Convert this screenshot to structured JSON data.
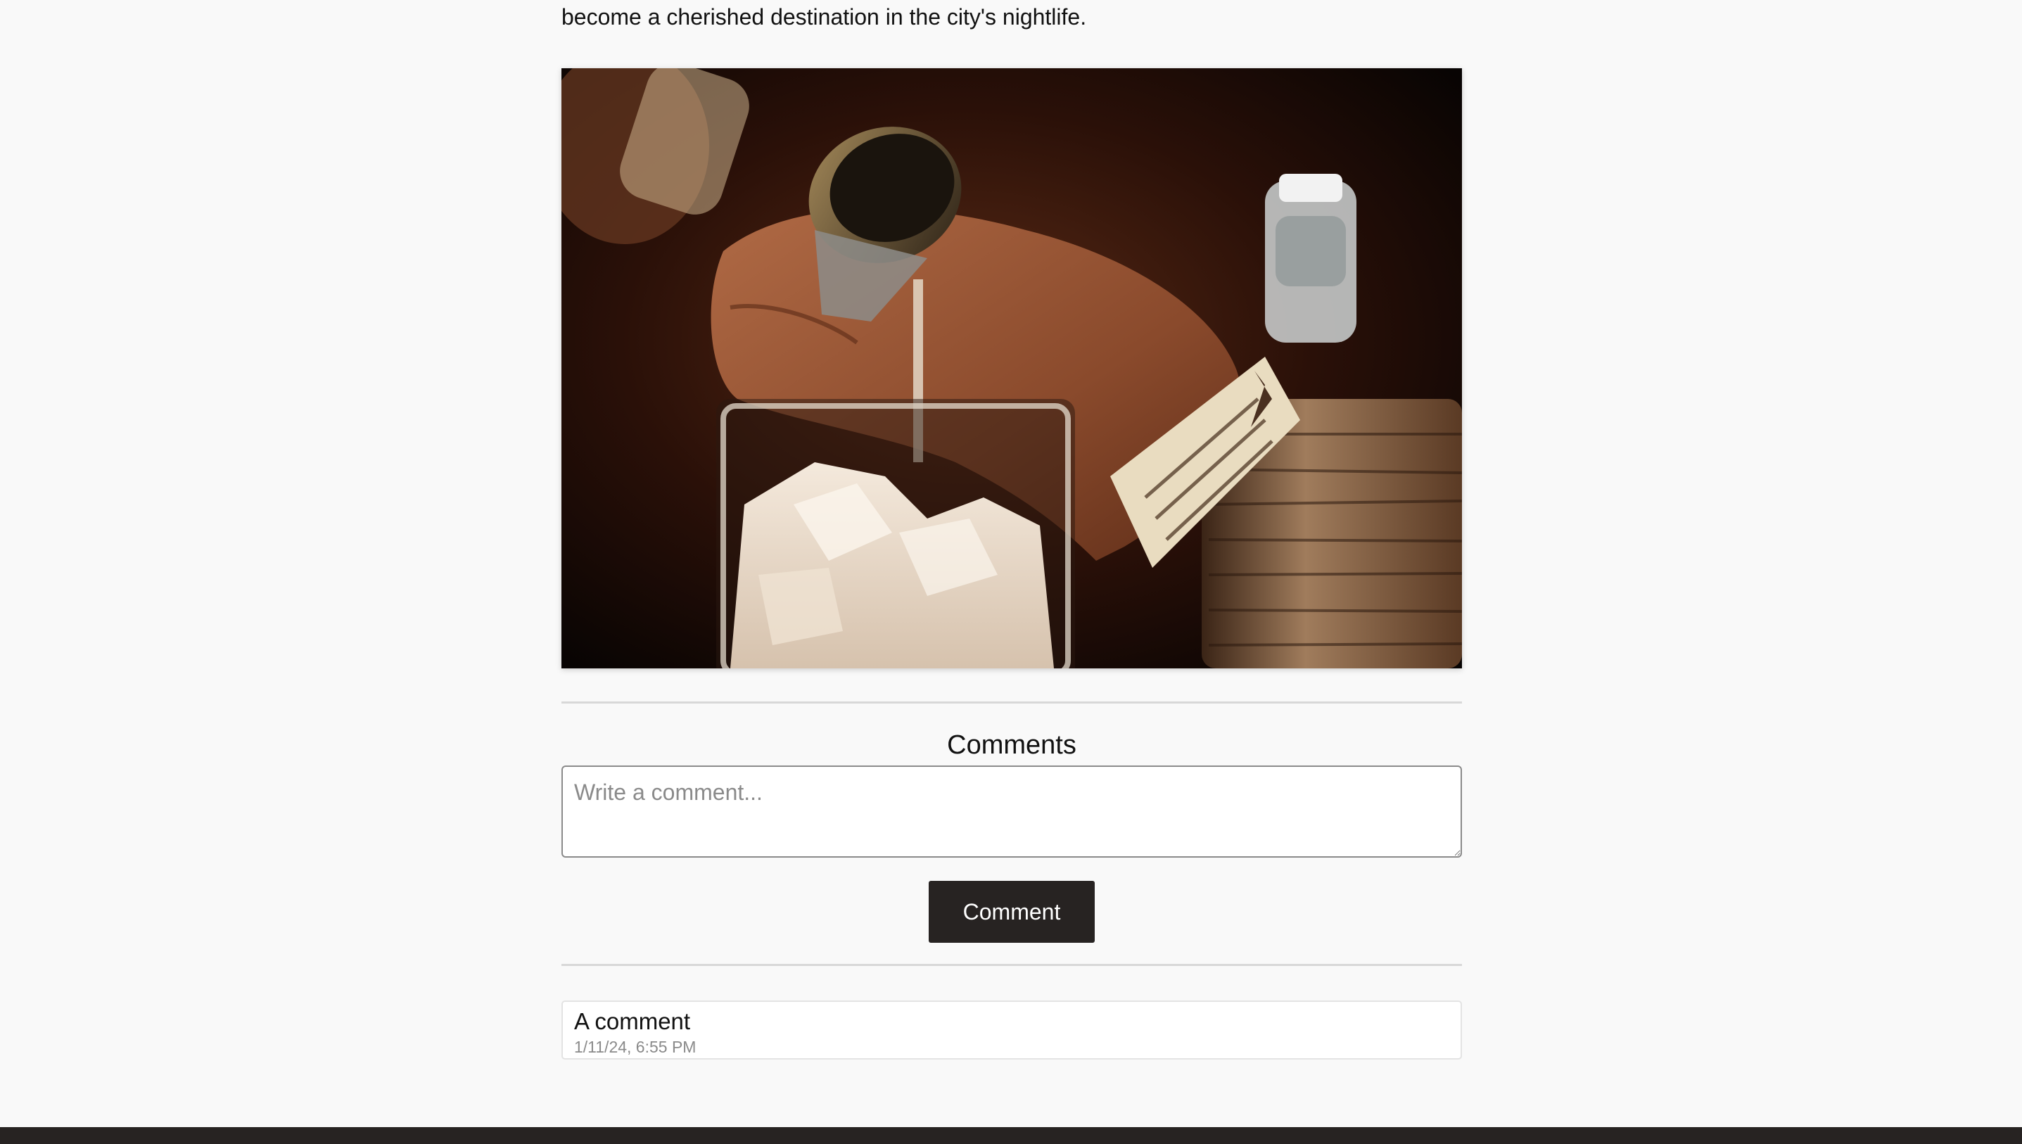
{
  "article": {
    "intro_text": "become a cherished destination in the city's nightlife.",
    "image_alt": "Bartender pouring a spirit from a jigger into a mixing glass with ice beside a bottle"
  },
  "comments": {
    "heading": "Comments",
    "input_placeholder": "Write a comment...",
    "input_value": "",
    "submit_label": "Comment",
    "items": [
      {
        "text": "A comment",
        "timestamp": "1/11/24, 6:55 PM"
      }
    ]
  },
  "colors": {
    "background": "#f9f9f9",
    "button": "#272322",
    "footer": "#272322",
    "muted_text": "#8a8a8a"
  }
}
